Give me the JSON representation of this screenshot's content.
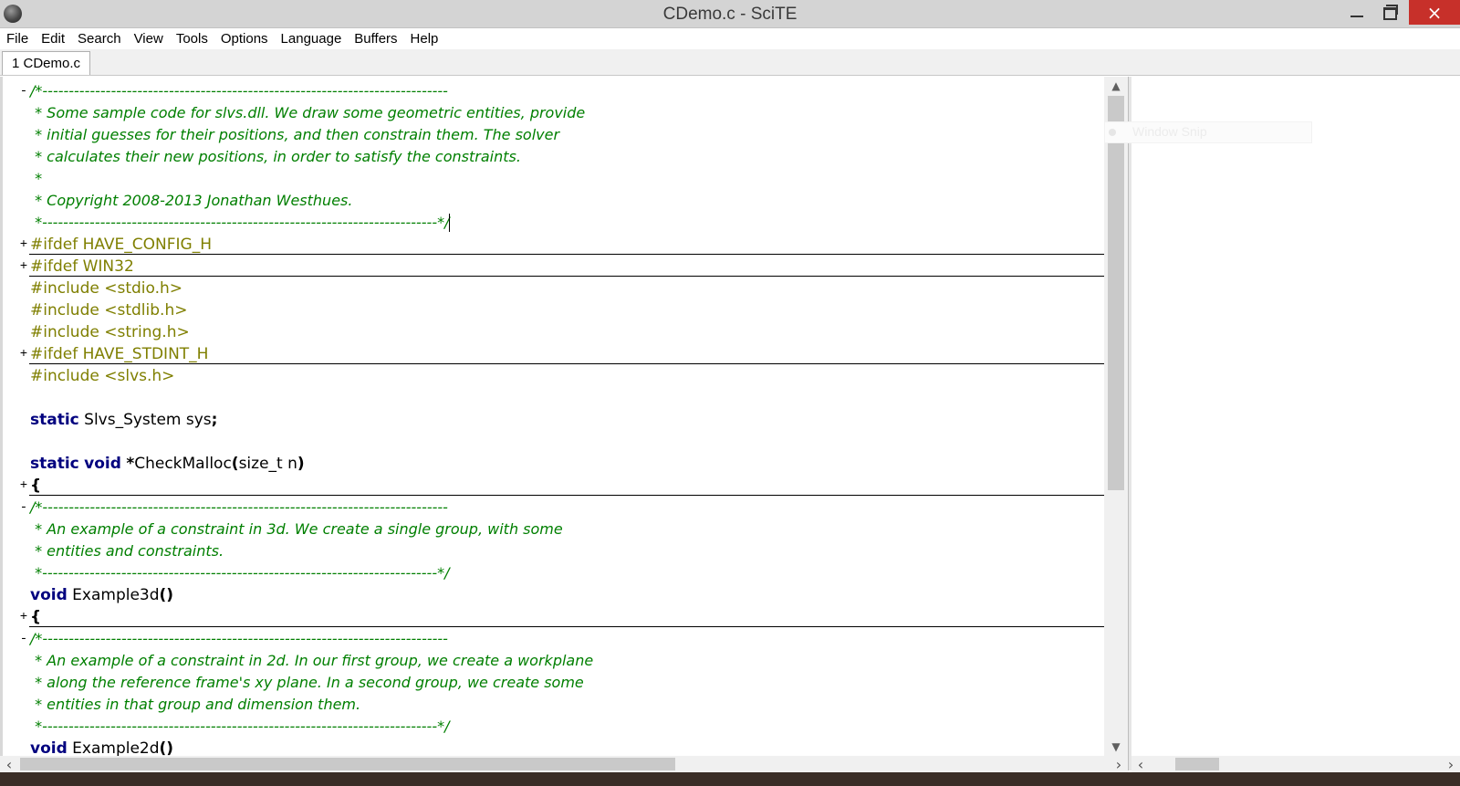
{
  "window": {
    "title": "CDemo.c - SciTE"
  },
  "menu": [
    "File",
    "Edit",
    "Search",
    "View",
    "Tools",
    "Options",
    "Language",
    "Buffers",
    "Help"
  ],
  "tabs": [
    "1 CDemo.c"
  ],
  "code_lines": [
    {
      "fold": "-",
      "folded": false,
      "tokens": [
        {
          "t": "cm",
          "v": "/*-----------------------------------------------------------------------------"
        }
      ]
    },
    {
      "fold": "",
      "folded": false,
      "tokens": [
        {
          "t": "cm",
          "v": " * Some sample code for slvs.dll. We draw some geometric entities, provide"
        }
      ]
    },
    {
      "fold": "",
      "folded": false,
      "tokens": [
        {
          "t": "cm",
          "v": " * initial guesses for their positions, and then constrain them. The solver"
        }
      ]
    },
    {
      "fold": "",
      "folded": false,
      "tokens": [
        {
          "t": "cm",
          "v": " * calculates their new positions, in order to satisfy the constraints."
        }
      ]
    },
    {
      "fold": "",
      "folded": false,
      "tokens": [
        {
          "t": "cm",
          "v": " *"
        }
      ]
    },
    {
      "fold": "",
      "folded": false,
      "tokens": [
        {
          "t": "cm",
          "v": " * Copyright 2008-2013 Jonathan Westhues."
        }
      ]
    },
    {
      "fold": "",
      "folded": false,
      "caret": true,
      "tokens": [
        {
          "t": "cm",
          "v": " *---------------------------------------------------------------------------*/"
        }
      ]
    },
    {
      "fold": "+",
      "folded": true,
      "tokens": [
        {
          "t": "pp",
          "v": "#ifdef HAVE_CONFIG_H"
        }
      ]
    },
    {
      "fold": "+",
      "folded": true,
      "tokens": [
        {
          "t": "pp",
          "v": "#ifdef WIN32"
        }
      ]
    },
    {
      "fold": "",
      "folded": false,
      "tokens": [
        {
          "t": "pp",
          "v": "#include <stdio.h>"
        }
      ]
    },
    {
      "fold": "",
      "folded": false,
      "tokens": [
        {
          "t": "pp",
          "v": "#include <stdlib.h>"
        }
      ]
    },
    {
      "fold": "",
      "folded": false,
      "tokens": [
        {
          "t": "pp",
          "v": "#include <string.h>"
        }
      ]
    },
    {
      "fold": "+",
      "folded": true,
      "tokens": [
        {
          "t": "pp",
          "v": "#ifdef HAVE_STDINT_H"
        }
      ]
    },
    {
      "fold": "",
      "folded": false,
      "tokens": [
        {
          "t": "pp",
          "v": "#include <slvs.h>"
        }
      ]
    },
    {
      "fold": "",
      "folded": false,
      "tokens": []
    },
    {
      "fold": "",
      "folded": false,
      "tokens": [
        {
          "t": "kw",
          "v": "static"
        },
        {
          "t": "id",
          "v": " Slvs_System sys"
        },
        {
          "t": "op",
          "v": ";"
        }
      ]
    },
    {
      "fold": "",
      "folded": false,
      "tokens": []
    },
    {
      "fold": "",
      "folded": false,
      "tokens": [
        {
          "t": "kw",
          "v": "static"
        },
        {
          "t": "id",
          "v": " "
        },
        {
          "t": "kw",
          "v": "void"
        },
        {
          "t": "id",
          "v": " "
        },
        {
          "t": "op",
          "v": "*"
        },
        {
          "t": "id",
          "v": "CheckMalloc"
        },
        {
          "t": "op",
          "v": "("
        },
        {
          "t": "id",
          "v": "size_t n"
        },
        {
          "t": "op",
          "v": ")"
        }
      ]
    },
    {
      "fold": "+",
      "folded": true,
      "tokens": [
        {
          "t": "op",
          "v": "{"
        }
      ]
    },
    {
      "fold": "-",
      "folded": false,
      "tokens": [
        {
          "t": "cm",
          "v": "/*-----------------------------------------------------------------------------"
        }
      ]
    },
    {
      "fold": "",
      "folded": false,
      "tokens": [
        {
          "t": "cm",
          "v": " * An example of a constraint in 3d. We create a single group, with some"
        }
      ]
    },
    {
      "fold": "",
      "folded": false,
      "tokens": [
        {
          "t": "cm",
          "v": " * entities and constraints."
        }
      ]
    },
    {
      "fold": "",
      "folded": false,
      "tokens": [
        {
          "t": "cm",
          "v": " *---------------------------------------------------------------------------*/"
        }
      ]
    },
    {
      "fold": "",
      "folded": false,
      "tokens": [
        {
          "t": "kw",
          "v": "void"
        },
        {
          "t": "id",
          "v": " Example3d"
        },
        {
          "t": "op",
          "v": "()"
        }
      ]
    },
    {
      "fold": "+",
      "folded": true,
      "tokens": [
        {
          "t": "op",
          "v": "{"
        }
      ]
    },
    {
      "fold": "-",
      "folded": false,
      "tokens": [
        {
          "t": "cm",
          "v": "/*-----------------------------------------------------------------------------"
        }
      ]
    },
    {
      "fold": "",
      "folded": false,
      "tokens": [
        {
          "t": "cm",
          "v": " * An example of a constraint in 2d. In our first group, we create a workplane"
        }
      ]
    },
    {
      "fold": "",
      "folded": false,
      "tokens": [
        {
          "t": "cm",
          "v": " * along the reference frame's xy plane. In a second group, we create some"
        }
      ]
    },
    {
      "fold": "",
      "folded": false,
      "tokens": [
        {
          "t": "cm",
          "v": " * entities in that group and dimension them."
        }
      ]
    },
    {
      "fold": "",
      "folded": false,
      "tokens": [
        {
          "t": "cm",
          "v": " *---------------------------------------------------------------------------*/"
        }
      ]
    },
    {
      "fold": "",
      "folded": false,
      "tokens": [
        {
          "t": "kw",
          "v": "void"
        },
        {
          "t": "id",
          "v": " Example2d"
        },
        {
          "t": "op",
          "v": "()"
        }
      ]
    }
  ],
  "overlay": {
    "ghost_label": "Window Snip"
  },
  "icons": {
    "close": "×",
    "scroll_up": "▲",
    "scroll_down": "▼",
    "scroll_left": "‹",
    "scroll_right": "›"
  }
}
